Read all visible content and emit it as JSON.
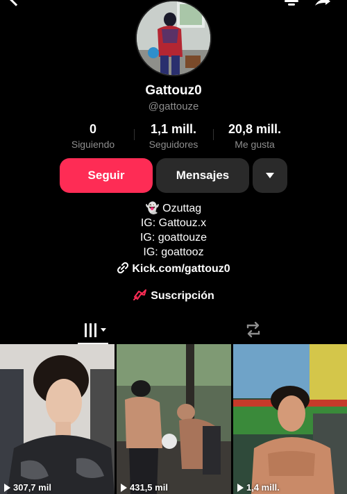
{
  "profile": {
    "display_name": "Gattouz0",
    "handle": "@gattouze"
  },
  "stats": [
    {
      "value": "0",
      "label": "Siguiendo"
    },
    {
      "value": "1,1 mill.",
      "label": "Seguidores"
    },
    {
      "value": "20,8 mill.",
      "label": "Me gusta"
    }
  ],
  "actions": {
    "follow_label": "Seguir",
    "message_label": "Mensajes"
  },
  "bio": {
    "lines": [
      "👻 Ozuttag",
      "IG: Gattouz.x",
      "IG: goattouze",
      "IG: goattooz"
    ],
    "link": "Kick.com/gattouz0"
  },
  "subscription": {
    "label": "Suscripción"
  },
  "videos": [
    {
      "views": "307,7 mil"
    },
    {
      "views": "431,5 mil"
    },
    {
      "views": "1,4 mill."
    }
  ],
  "colors": {
    "accent": "#fe2c55",
    "secondary_button": "#2a2a2a",
    "muted_text": "#8e8e8e"
  }
}
